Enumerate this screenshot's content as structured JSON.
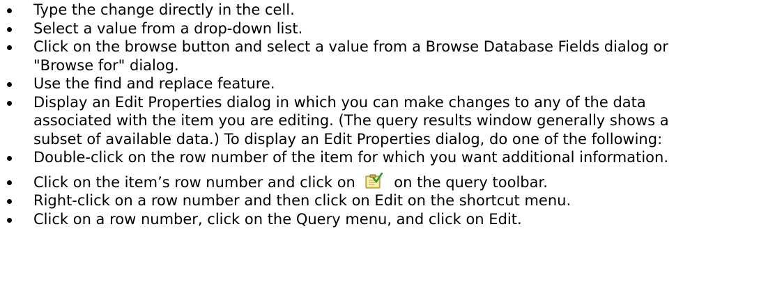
{
  "bullets": [
    {
      "text": "Type the change directly in the cell."
    },
    {
      "text": "Select a value from a drop-down list."
    },
    {
      "text": "Click on the browse button and select a value from a Browse Database Fields dialog or"
    },
    {
      "text": "\"Browse for\" dialog."
    },
    {
      "text": "Use the find and replace feature."
    },
    {
      "text": "Display an Edit Properties dialog in which you can make changes to any of the data"
    },
    {
      "text": "associated with the item you are editing. (The query results window generally shows a"
    },
    {
      "text": "subset of available data.) To display an Edit Properties dialog, do one of the following:"
    },
    {
      "text": "Double-click on the row number of the item for which you want additional information."
    },
    {
      "text_before": "Click on the item’s row number and click on",
      "icon": "edit-properties-icon",
      "text_after": "on the query toolbar."
    },
    {
      "text": "Right-click on a row number and then click on Edit on the shortcut menu."
    },
    {
      "text": "Click on a row number, click on the Query menu, and click on Edit."
    }
  ]
}
